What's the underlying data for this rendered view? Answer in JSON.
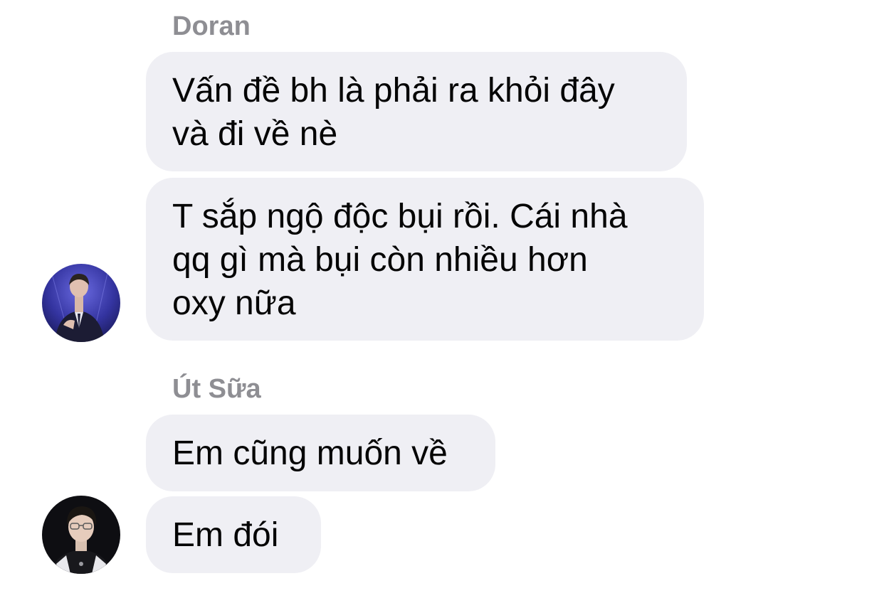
{
  "groups": [
    {
      "sender": "Doran",
      "messages": [
        "Vấn đề bh là phải ra khỏi đây\nvà đi về nè",
        "T sắp ngộ độc bụi rồi. Cái nhà\nqq gì mà bụi còn nhiều hơn\noxy nữa"
      ],
      "avatar_icon": "profile-photo-icon",
      "avatar_background": "#3a3aa8"
    },
    {
      "sender": "Út Sữa",
      "messages": [
        "Em cũng muốn về",
        "Em đói"
      ],
      "avatar_icon": "profile-photo-icon",
      "avatar_background": "#0e0e12"
    }
  ],
  "colors": {
    "bubble_background": "#efeff4",
    "sender_name": "#8e8e93",
    "message_text": "#050505"
  }
}
